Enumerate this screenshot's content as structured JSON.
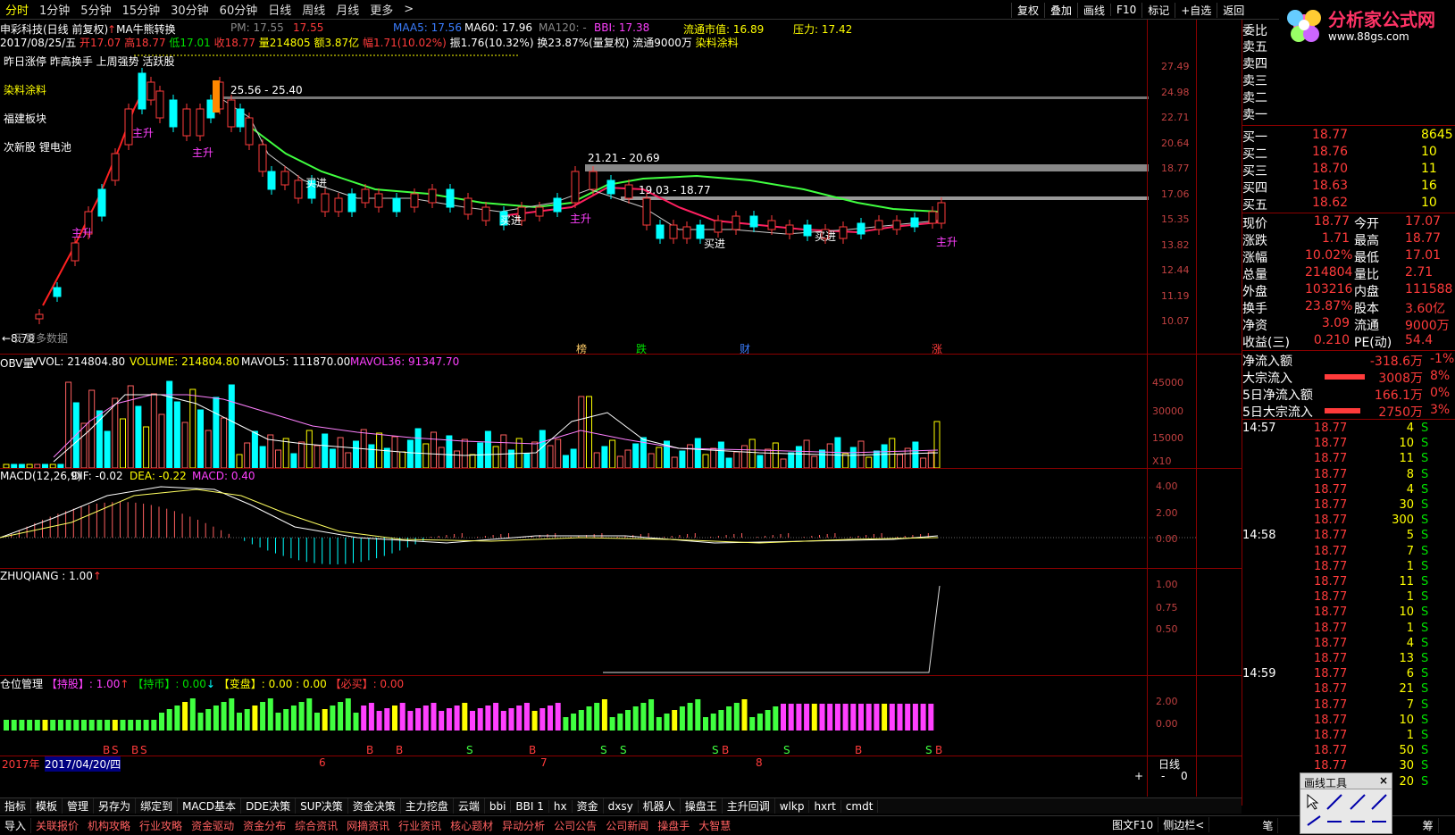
{
  "topbar": {
    "items": [
      "分时",
      "1分钟",
      "5分钟",
      "15分钟",
      "30分钟",
      "60分钟",
      "日线",
      "周线",
      "月线",
      "更多"
    ],
    "active_index": 0,
    "right": [
      "复权",
      "叠加",
      "画线",
      "F10",
      "标记",
      "+自选",
      "返回"
    ]
  },
  "logo": {
    "title": "分析家公式网",
    "url": "www.88gs.com"
  },
  "stock_header": {
    "name": "申彩科技(日线 前复权)",
    "ma_label": "MA牛熊转换",
    "pm": "PM: 17.55",
    "p2": "17.55",
    "maa5": "MAA5: 17.56",
    "ma60": "MA60: 17.96",
    "ma120": "MA120: -",
    "bbi": "BBI: 17.38",
    "float_value": "流通市值: 16.89",
    "pressure": "压力: 17.42"
  },
  "ohlc_line": {
    "date": "2017/08/25/五",
    "open": "开17.07",
    "high": "高18.77",
    "low": "低17.01",
    "close": "收18.77",
    "volume": "量214805",
    "amount": "额3.87亿",
    "change": "幅1.71(10.02%)",
    "amplitude": "振1.76(10.32%)",
    "turnover": "换23.87%(量复权)",
    "float": "流通9000万",
    "sector": "染料涂料"
  },
  "chart_notes": {
    "line1": "昨日涨停 昨高换手 上周强势 活跃股",
    "tag1": "染料涂料",
    "tag2": "福建板块",
    "tag3": "次新股 锂电池",
    "range1": "25.56 - 25.40",
    "range2": "21.21 - 20.69",
    "range3": "19.03 - 18.77",
    "low_label": "←8.78",
    "no_data": "无更多数据",
    "sig_rise": "主升",
    "sig_buy": "买进",
    "events": [
      "榜",
      "跌",
      "财",
      "涨"
    ]
  },
  "price_axis": [
    "27.49",
    "24.98",
    "22.71",
    "20.64",
    "18.77",
    "17.06",
    "15.35",
    "13.82",
    "12.44",
    "11.19",
    "10.07"
  ],
  "vol_header": {
    "title": "OBV量",
    "vvol": "VVOL: 214804.80",
    "volume": "VOLUME: 214804.80",
    "mavol5": "MAVOL5: 111870.00",
    "mavol36": "MAVOL36: 91347.70"
  },
  "vol_axis": [
    "45000",
    "30000",
    "15000",
    "X10"
  ],
  "macd_header": {
    "title": "MACD(12,26,9)",
    "dif": "DIF: -0.02",
    "dea": "DEA: -0.22",
    "macd": "MACD: 0.40"
  },
  "macd_axis": [
    "4.00",
    "2.00",
    "0.00"
  ],
  "zq_header": {
    "title": "ZHUQIANG : 1.00"
  },
  "zq_axis": [
    "1.00",
    "0.75",
    "0.50"
  ],
  "pos_header": {
    "title": "仓位管理",
    "hold": "【持股】: 1.00",
    "cash": "【持币】: 0.00",
    "change": "【变盘】: 0.00 : 0.00",
    "must_buy": "【必买】: 0.00"
  },
  "pos_axis": [
    "2.00",
    "0.00"
  ],
  "date_axis": {
    "year": "2017年",
    "date": "2017/04/20/四",
    "m6": "6",
    "m7": "7",
    "m8": "8",
    "period": "日线"
  },
  "scroll": {
    "plus": "+",
    "minus": "-",
    "zero": "0"
  },
  "order_book": {
    "header": "委比",
    "sells": [
      {
        "label": "卖五",
        "price": "",
        "vol": ""
      },
      {
        "label": "卖四",
        "price": "",
        "vol": ""
      },
      {
        "label": "卖三",
        "price": "",
        "vol": ""
      },
      {
        "label": "卖二",
        "price": "",
        "vol": ""
      },
      {
        "label": "卖一",
        "price": "",
        "vol": ""
      }
    ],
    "buys": [
      {
        "label": "买一",
        "price": "18.77",
        "vol": "8645"
      },
      {
        "label": "买二",
        "price": "18.76",
        "vol": "10"
      },
      {
        "label": "买三",
        "price": "18.70",
        "vol": "11"
      },
      {
        "label": "买四",
        "price": "18.63",
        "vol": "16"
      },
      {
        "label": "买五",
        "price": "18.62",
        "vol": "10"
      }
    ]
  },
  "quote": [
    {
      "l1": "现价",
      "v1": "18.77",
      "l2": "今开",
      "v2": "17.07"
    },
    {
      "l1": "涨跌",
      "v1": "1.71",
      "l2": "最高",
      "v2": "18.77"
    },
    {
      "l1": "涨幅",
      "v1": "10.02%",
      "l2": "最低",
      "v2": "17.01"
    },
    {
      "l1": "总量",
      "v1": "214804",
      "l2": "量比",
      "v2": "2.71"
    },
    {
      "l1": "外盘",
      "v1": "103216",
      "l2": "内盘",
      "v2": "111588"
    },
    {
      "l1": "换手",
      "v1": "23.87%",
      "l2": "股本",
      "v2": "3.60亿"
    },
    {
      "l1": "净资",
      "v1": "3.09",
      "l2": "流通",
      "v2": "9000万"
    },
    {
      "l1": "收益(三)",
      "v1": "0.210",
      "l2": "PE(动)",
      "v2": "54.4"
    }
  ],
  "flows": [
    {
      "label": "净流入额",
      "value": "-318.6万",
      "pct": "-1%"
    },
    {
      "label": "大宗流入",
      "value": "3008万",
      "pct": "8%"
    },
    {
      "label": "5日净流入额",
      "value": "166.1万",
      "pct": "0%"
    },
    {
      "label": "5日大宗流入",
      "value": "2750万",
      "pct": "3%"
    }
  ],
  "ticks": [
    {
      "time": "14:57",
      "price": "18.77",
      "vol": "4",
      "side": "S"
    },
    {
      "time": "",
      "price": "18.77",
      "vol": "10",
      "side": "S"
    },
    {
      "time": "",
      "price": "18.77",
      "vol": "11",
      "side": "S"
    },
    {
      "time": "",
      "price": "18.77",
      "vol": "8",
      "side": "S"
    },
    {
      "time": "",
      "price": "18.77",
      "vol": "4",
      "side": "S"
    },
    {
      "time": "",
      "price": "18.77",
      "vol": "30",
      "side": "S"
    },
    {
      "time": "",
      "price": "18.77",
      "vol": "300",
      "side": "S"
    },
    {
      "time": "14:58",
      "price": "18.77",
      "vol": "5",
      "side": "S"
    },
    {
      "time": "",
      "price": "18.77",
      "vol": "7",
      "side": "S"
    },
    {
      "time": "",
      "price": "18.77",
      "vol": "1",
      "side": "S"
    },
    {
      "time": "",
      "price": "18.77",
      "vol": "11",
      "side": "S"
    },
    {
      "time": "",
      "price": "18.77",
      "vol": "1",
      "side": "S"
    },
    {
      "time": "",
      "price": "18.77",
      "vol": "10",
      "side": "S"
    },
    {
      "time": "",
      "price": "18.77",
      "vol": "1",
      "side": "S"
    },
    {
      "time": "",
      "price": "18.77",
      "vol": "4",
      "side": "S"
    },
    {
      "time": "",
      "price": "18.77",
      "vol": "13",
      "side": "S"
    },
    {
      "time": "14:59",
      "price": "18.77",
      "vol": "6",
      "side": "S"
    },
    {
      "time": "",
      "price": "18.77",
      "vol": "21",
      "side": "S"
    },
    {
      "time": "",
      "price": "18.77",
      "vol": "7",
      "side": "S"
    },
    {
      "time": "",
      "price": "18.77",
      "vol": "10",
      "side": "S"
    },
    {
      "time": "",
      "price": "18.77",
      "vol": "1",
      "side": "S"
    },
    {
      "time": "",
      "price": "18.77",
      "vol": "50",
      "side": "S"
    },
    {
      "time": "",
      "price": "18.77",
      "vol": "30",
      "side": "S"
    },
    {
      "time": "",
      "price": "18.77",
      "vol": "20",
      "side": "S"
    }
  ],
  "bottom_tabs1": [
    "指标",
    "模板",
    "管理",
    "另存为",
    "绑定到",
    "MACD基本",
    "DDE决策",
    "SUP决策",
    "资金决策",
    "主力挖盘",
    "云端",
    "bbi",
    "BBI 1",
    "hx",
    "资金",
    "dxsy",
    "机器人",
    "操盘王",
    "主升回调",
    "wlkp",
    "hxrt",
    "cmdt"
  ],
  "bottom_tabs2": [
    "导入",
    "关联报价",
    "机构攻略",
    "行业攻略",
    "资金驱动",
    "资金分布",
    "综合资讯",
    "网摘资讯",
    "行业资讯",
    "核心题材",
    "异动分析",
    "公司公告",
    "公司新闻",
    "操盘手",
    "大智慧"
  ],
  "bottom_right": [
    "图文F10",
    "侧边栏<",
    "笔",
    "价",
    "主",
    "筹"
  ],
  "drawtool": {
    "title": "画线工具",
    "close": "×"
  },
  "colors": {
    "up": "#ff3b3b",
    "down": "#00ffff",
    "ma_red": "#ff2060",
    "ma_green": "#40ff40",
    "grid": "#8b0000"
  }
}
